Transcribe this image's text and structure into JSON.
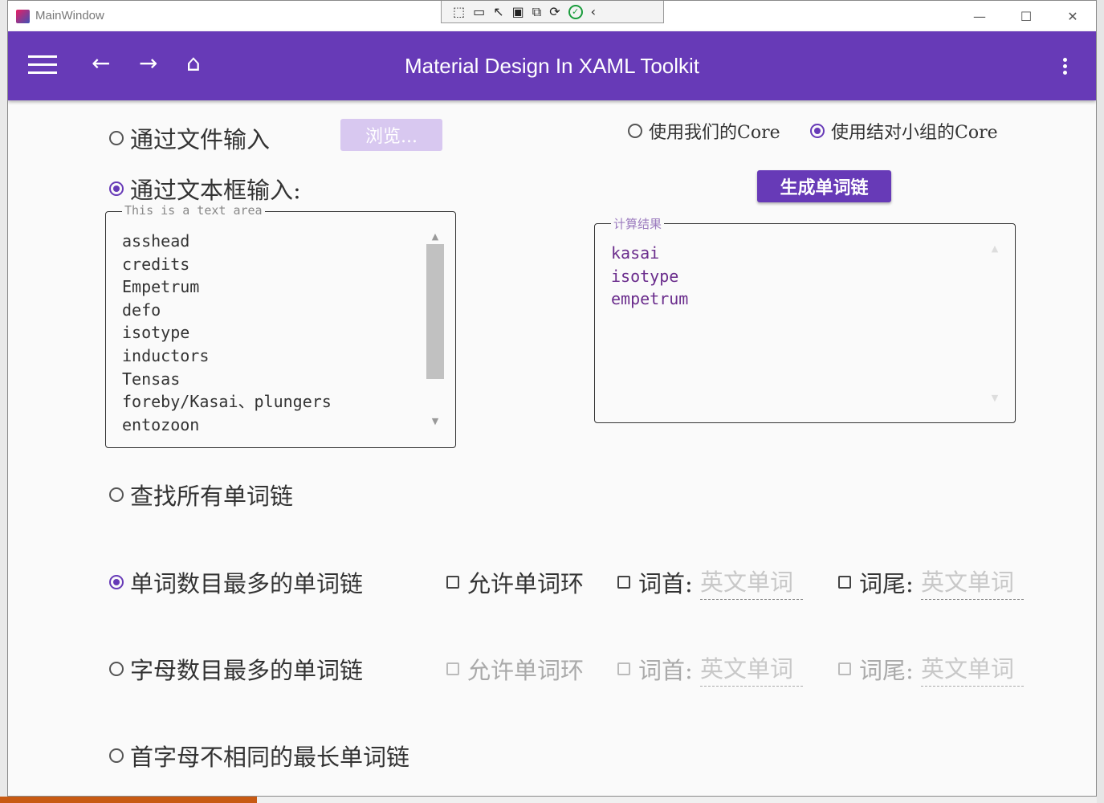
{
  "window": {
    "title": "MainWindow",
    "minimize": "—",
    "maximize": "☐",
    "close": "✕"
  },
  "appbar": {
    "title": "Material Design In XAML Toolkit"
  },
  "input": {
    "file_radio": "通过文件输入",
    "browse_button": "浏览...",
    "textbox_radio": "通过文本框输入:",
    "textarea_hint": "This is a text area",
    "textarea_lines": [
      "asshead",
      "credits",
      "Empetrum",
      "defo",
      "isotype",
      "inductors",
      "Tensas",
      "foreby/Kasai、plungers",
      "entozoon"
    ]
  },
  "core": {
    "ours": "使用我们的Core",
    "pair": "使用结对小组的Core"
  },
  "generate_button": "生成单词链",
  "result": {
    "label": "计算结果",
    "lines": [
      "kasai",
      "isotype",
      "empetrum"
    ]
  },
  "modes": {
    "all": "查找所有单词链",
    "most_words": "单词数目最多的单词链",
    "most_letters": "字母数目最多的单词链",
    "distinct_first": "首字母不相同的最长单词链"
  },
  "options": {
    "allow_loop": "允许单词环",
    "head": "词首:",
    "tail": "词尾:",
    "word_placeholder": "英文单词"
  },
  "state": {
    "file_selected": false,
    "textbox_selected": true,
    "core_ours": false,
    "core_pair": true,
    "mode_selected": "most_words"
  }
}
